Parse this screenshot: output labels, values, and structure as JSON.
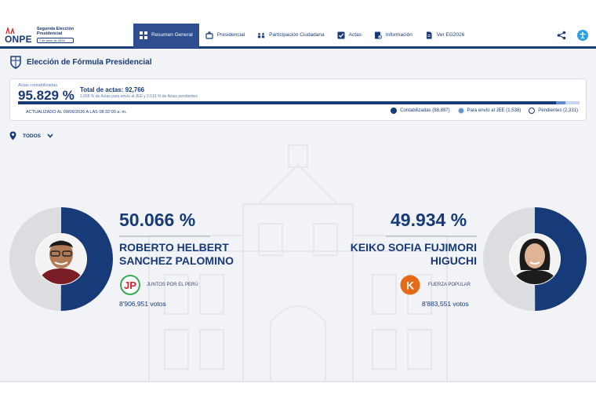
{
  "header": {
    "logo_word": "ONPE",
    "logo_title_line1": "Segunda Elección",
    "logo_title_line2": "Presidencial",
    "logo_date": "7 de junio de 2026",
    "nav": [
      {
        "label": "Resumen General",
        "icon": "grid-icon",
        "active": true
      },
      {
        "label": "Presidencial",
        "icon": "ballot-icon",
        "active": false
      },
      {
        "label": "Participación Ciudadana",
        "icon": "people-icon",
        "active": false
      },
      {
        "label": "Actas",
        "icon": "checkbox-icon",
        "active": false
      },
      {
        "label": "Información",
        "icon": "info-doc-icon",
        "active": false
      },
      {
        "label": "Ver EG2026",
        "icon": "document-icon",
        "active": false
      }
    ]
  },
  "page": {
    "title": "Elección de Fórmula Presidencial"
  },
  "stats": {
    "counted_label": "Actas contabilizadas",
    "counted_pct": "95.829 %",
    "total_label": "Total de actas: 92,766",
    "sub_label": "1.658 % de Actas para envío al JEE y 2.513 % de Actas pendientes",
    "updated": "ACTUALIZADO AL 09/06/2026 A LAS 08:32:00 a. m.",
    "progress_counted_pct": 95.829,
    "progress_jee_pct": 1.658,
    "legend": [
      {
        "label": "Contabilizadas (88,897)",
        "color": "#173a78",
        "ring": false
      },
      {
        "label": "Para envío al JEE (1,538)",
        "color": "#5f8fd0",
        "ring": true
      },
      {
        "label": "Pendientes (2,331)",
        "color": "#ffffff",
        "ring": true
      }
    ]
  },
  "filter": {
    "label": "TODOS"
  },
  "candidates": [
    {
      "pct": "50.066 %",
      "share": 50.066,
      "name_line1": "ROBERTO HELBERT",
      "name_line2": "SANCHEZ PALOMINO",
      "party": "JUNTOS POR EL PERÚ",
      "party_mark": "JP",
      "votes": "8'906,951 votos"
    },
    {
      "pct": "49.934 %",
      "share": 49.934,
      "name_line1": "KEIKO SOFIA FUJIMORI",
      "name_line2": "HIGUCHI",
      "party": "FUERZA POPULAR",
      "party_mark": "K",
      "votes": "8'883,551 votos"
    }
  ],
  "colors": {
    "primary": "#173a78",
    "accent": "#2e4e8f",
    "donut_rest": "#dcdde1",
    "fp_orange": "#e56a16",
    "jp_green": "#2fa84f",
    "jp_red": "#d8232a"
  }
}
